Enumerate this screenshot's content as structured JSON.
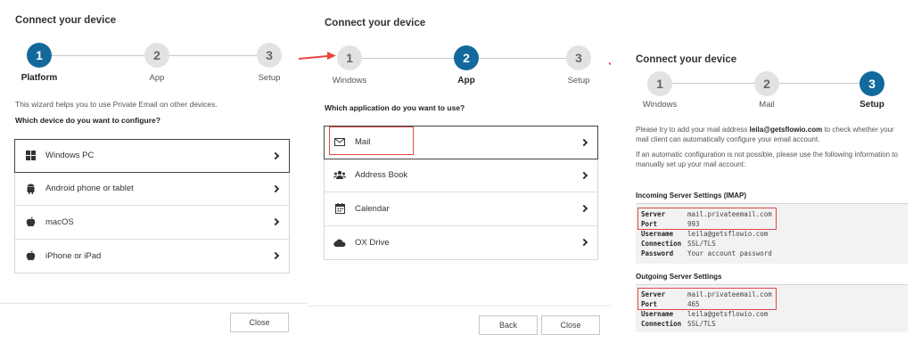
{
  "panel1": {
    "title": "Connect your device",
    "steps": [
      {
        "num": "1",
        "label": "Platform",
        "active": true
      },
      {
        "num": "2",
        "label": "App",
        "active": false
      },
      {
        "num": "3",
        "label": "Setup",
        "active": false
      }
    ],
    "intro": "This wizard helps you to use Private Email on other devices.",
    "question": "Which device do you want to configure?",
    "devices": [
      {
        "label": "Windows PC",
        "icon": "windows-icon",
        "selected": true
      },
      {
        "label": "Android phone or tablet",
        "icon": "android-icon",
        "selected": false
      },
      {
        "label": "macOS",
        "icon": "apple-icon",
        "selected": false
      },
      {
        "label": "iPhone or iPad",
        "icon": "apple-icon",
        "selected": false
      }
    ],
    "close": "Close"
  },
  "panel2": {
    "title": "Connect your device",
    "steps": [
      {
        "num": "1",
        "label": "Windows",
        "active": false
      },
      {
        "num": "2",
        "label": "App",
        "active": true
      },
      {
        "num": "3",
        "label": "Setup",
        "active": false
      }
    ],
    "question": "Which application do you want to use?",
    "apps": [
      {
        "label": "Mail",
        "icon": "envelope-icon",
        "selected": true
      },
      {
        "label": "Address Book",
        "icon": "contacts-icon",
        "selected": false
      },
      {
        "label": "Calendar",
        "icon": "calendar-icon",
        "selected": false
      },
      {
        "label": "OX Drive",
        "icon": "cloud-icon",
        "selected": false
      }
    ],
    "back": "Back",
    "close": "Close"
  },
  "panel3": {
    "title": "Connect your device",
    "steps": [
      {
        "num": "1",
        "label": "Windows",
        "active": false
      },
      {
        "num": "2",
        "label": "Mail",
        "active": false
      },
      {
        "num": "3",
        "label": "Setup",
        "active": true
      }
    ],
    "p1_before": "Please try to add your mail address ",
    "p1_email": "leila@getsflowio.com",
    "p1_after": " to check whether your mail client can automatically configure your email account.",
    "p2": "If an automatic configuration is not possible, please use the following information to manually set up your mail account:",
    "incoming_title": "Incoming Server Settings (IMAP)",
    "incoming": [
      {
        "key": "Server",
        "value": "mail.privateemail.com"
      },
      {
        "key": "Port",
        "value": "993"
      },
      {
        "key": "Username",
        "value": "leila@getsflowio.com"
      },
      {
        "key": "Connection",
        "value": "SSL/TLS"
      },
      {
        "key": "Password",
        "value": "Your account password"
      }
    ],
    "outgoing_title": "Outgoing Server Settings",
    "outgoing": [
      {
        "key": "Server",
        "value": "mail.privateemail.com"
      },
      {
        "key": "Port",
        "value": "465"
      },
      {
        "key": "Username",
        "value": "leila@getsflowio.com"
      },
      {
        "key": "Connection",
        "value": "SSL/TLS"
      }
    ]
  },
  "colors": {
    "accent": "#13699c",
    "highlight": "#e04848",
    "arrow": "#e8473f"
  }
}
